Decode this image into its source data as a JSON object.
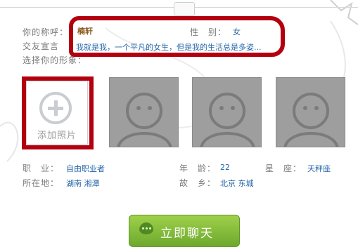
{
  "profile": {
    "nickname_label": "你的称呼：",
    "nickname": "楠轩",
    "gender_label": "性　别：",
    "gender": "女",
    "declaration_label": "交友宣言",
    "declaration": "我就是我，一个平凡的女生，但是我的生活总是多姿...",
    "choose_photo_label": "选择你的形象："
  },
  "photos": {
    "add_label": "添加照片"
  },
  "details": {
    "job_label": "职　业：",
    "job": "自由职业者",
    "age_label": "年　龄：",
    "age": "22",
    "sign_label": "星　座：",
    "sign": "天秤座",
    "location_label": "所在地：",
    "location": "湖南 湘潭",
    "hometown_label": "故　乡：",
    "hometown": "北京 东城"
  },
  "actions": {
    "chat_label": "立即聊天"
  },
  "colors": {
    "highlight_red": "#b3000f",
    "value_blue": "#2565a8",
    "button_green": "#7cb83a"
  }
}
